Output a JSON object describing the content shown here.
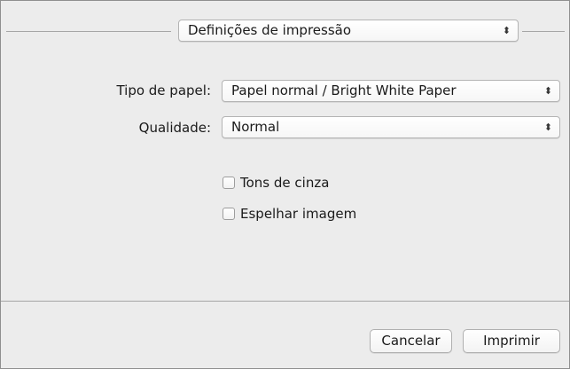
{
  "header": {
    "preset_popup": {
      "value": "Definições de impressão",
      "arrows_icon": "updown-arrows-icon"
    }
  },
  "form": {
    "paper_type": {
      "label": "Tipo de papel:",
      "value": "Papel normal / Bright White Paper",
      "arrows_icon": "updown-arrows-icon"
    },
    "quality": {
      "label": "Qualidade:",
      "value": "Normal",
      "arrows_icon": "updown-arrows-icon"
    },
    "checkboxes": [
      {
        "label": "Tons de cinza",
        "checked": false
      },
      {
        "label": "Espelhar imagem",
        "checked": false
      }
    ]
  },
  "footer": {
    "cancel_label": "Cancelar",
    "print_label": "Imprimir"
  }
}
